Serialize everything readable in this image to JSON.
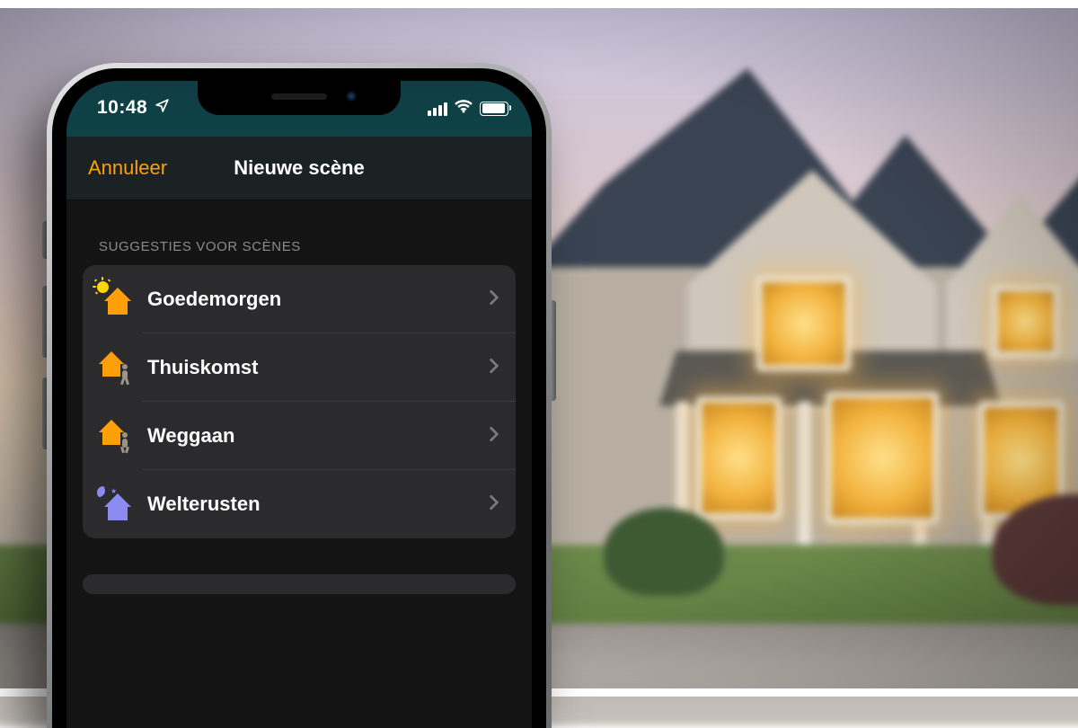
{
  "status": {
    "time": "10:48"
  },
  "nav": {
    "cancel": "Annuleer",
    "title": "Nieuwe scène"
  },
  "section": {
    "header": "SUGGESTIES VOOR SCÈNES"
  },
  "scenes": [
    {
      "label": "Goedemorgen",
      "icon": "sun-house"
    },
    {
      "label": "Thuiskomst",
      "icon": "house-arrive"
    },
    {
      "label": "Weggaan",
      "icon": "house-leave"
    },
    {
      "label": "Welterusten",
      "icon": "moon-house"
    }
  ],
  "colors": {
    "accent": "#ff9f0a",
    "nightIcon": "#8b8af0"
  }
}
